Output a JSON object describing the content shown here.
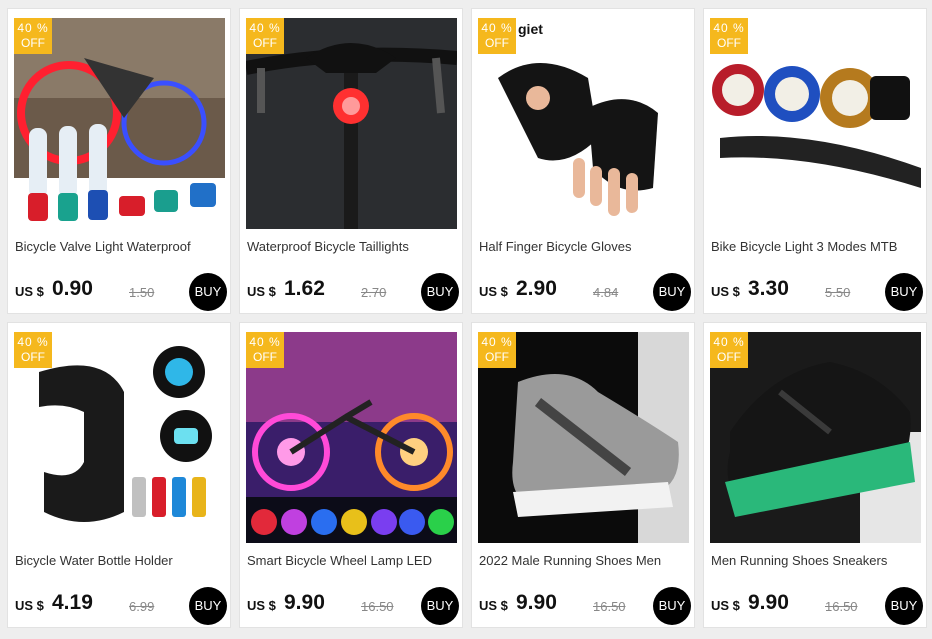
{
  "products": [
    {
      "badge_pct": "40 %",
      "badge_off": "OFF",
      "title": "Bicycle Valve Light Waterproof",
      "currency": "US $",
      "price": "0.90",
      "old_price": "1.50",
      "buy": "BUY",
      "image_icon": "bike-valve-light"
    },
    {
      "badge_pct": "40 %",
      "badge_off": "OFF",
      "title": "Waterproof Bicycle Taillights",
      "currency": "US $",
      "price": "1.62",
      "old_price": "2.70",
      "buy": "BUY",
      "image_icon": "bike-taillight"
    },
    {
      "badge_pct": "40 %",
      "badge_off": "OFF",
      "title": "Half Finger Bicycle Gloves",
      "currency": "US $",
      "price": "2.90",
      "old_price": "4.84",
      "buy": "BUY",
      "image_icon": "cycling-gloves",
      "image_text": "giet"
    },
    {
      "badge_pct": "40 %",
      "badge_off": "OFF",
      "title": "Bike Bicycle Light 3 Modes MTB",
      "currency": "US $",
      "price": "3.30",
      "old_price": "5.50",
      "buy": "BUY",
      "image_icon": "bike-headlights"
    },
    {
      "badge_pct": "40 %",
      "badge_off": "OFF",
      "title": "Bicycle Water Bottle Holder",
      "currency": "US $",
      "price": "4.19",
      "old_price": "6.99",
      "buy": "BUY",
      "image_icon": "bottle-holder"
    },
    {
      "badge_pct": "40 %",
      "badge_off": "OFF",
      "title": "Smart Bicycle Wheel Lamp LED",
      "currency": "US $",
      "price": "9.90",
      "old_price": "16.50",
      "buy": "BUY",
      "image_icon": "wheel-lamp"
    },
    {
      "badge_pct": "40 %",
      "badge_off": "OFF",
      "title": "2022 Male Running Shoes Men",
      "currency": "US $",
      "price": "9.90",
      "old_price": "16.50",
      "buy": "BUY",
      "image_icon": "running-shoe-grey"
    },
    {
      "badge_pct": "40 %",
      "badge_off": "OFF",
      "title": "Men Running Shoes Sneakers",
      "currency": "US $",
      "price": "9.90",
      "old_price": "16.50",
      "buy": "BUY",
      "image_icon": "running-shoe-green"
    }
  ],
  "colors": {
    "badge": "#f5b81d",
    "buy_button": "#000000",
    "page_bg": "#eeeeee"
  }
}
